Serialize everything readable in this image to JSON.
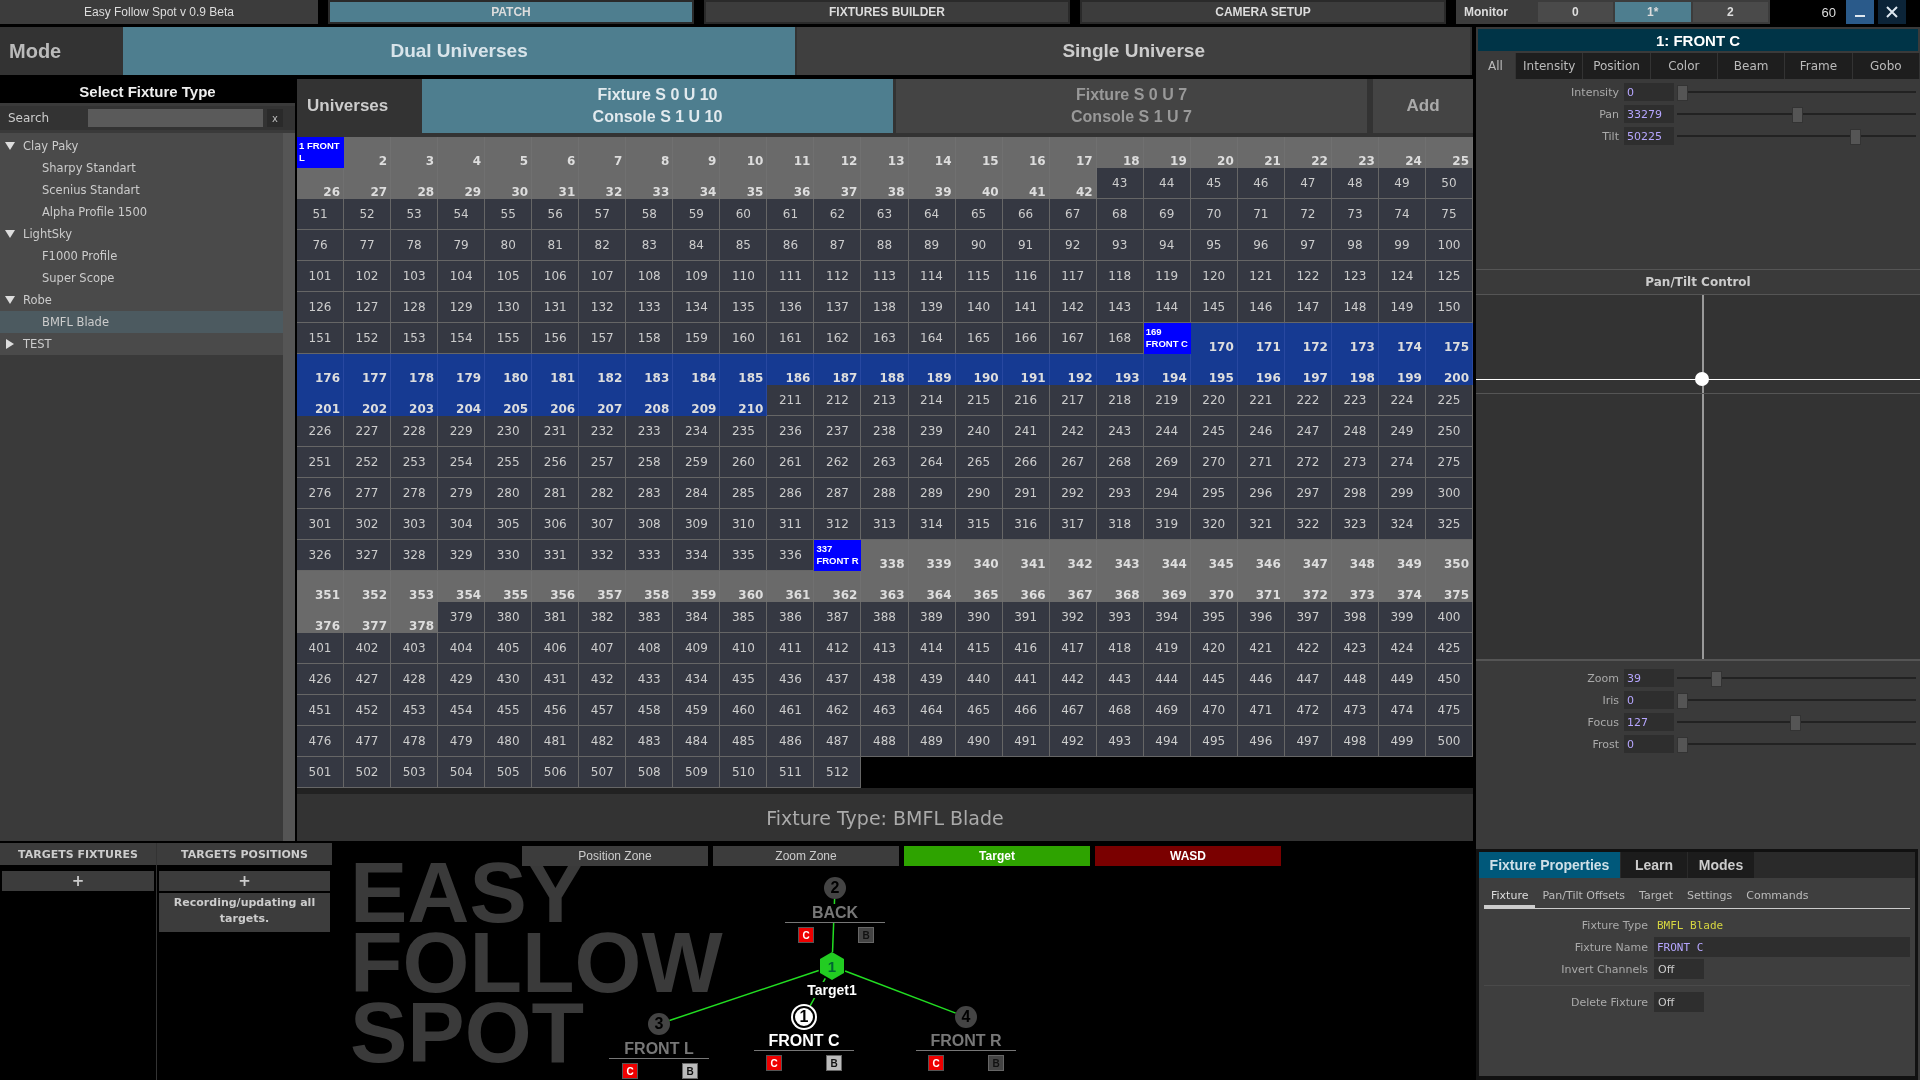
{
  "top_bar": {
    "title": "Easy Follow Spot v 0.9 Beta",
    "tabs": [
      {
        "label": "PATCH",
        "selected": true
      },
      {
        "label": "FIXTURES BUILDER",
        "selected": false
      },
      {
        "label": "CAMERA SETUP",
        "selected": false
      }
    ],
    "monitor": {
      "label": "Monitor",
      "items": [
        {
          "label": "0",
          "selected": false
        },
        {
          "label": "1*",
          "selected": true
        },
        {
          "label": "2",
          "selected": false
        }
      ]
    },
    "fps": "60"
  },
  "mode": {
    "label": "Mode",
    "options": [
      {
        "label": "Dual Universes",
        "selected": true
      },
      {
        "label": "Single Universe",
        "selected": false
      }
    ]
  },
  "fixture_types": {
    "title": "Select Fixture Type",
    "search": {
      "label": "Search",
      "clear": "x"
    },
    "tree": [
      {
        "label": "Clay Paky",
        "expanded": true,
        "selected": false,
        "children": [
          {
            "label": "Sharpy Standart",
            "selected": false
          },
          {
            "label": "Scenius Standart",
            "selected": false
          },
          {
            "label": "Alpha Profile 1500",
            "selected": false
          }
        ]
      },
      {
        "label": "LightSky",
        "expanded": true,
        "selected": false,
        "children": [
          {
            "label": "F1000 Profile",
            "selected": false
          },
          {
            "label": "Super Scope",
            "selected": false
          }
        ]
      },
      {
        "label": "Robe",
        "expanded": true,
        "selected": false,
        "children": [
          {
            "label": "BMFL Blade",
            "selected": true
          }
        ]
      },
      {
        "label": "TEST",
        "expanded": false,
        "selected": false
      }
    ]
  },
  "universes": {
    "label": "Universes",
    "items": [
      {
        "line1": "Fixture S 0 U 10",
        "line2": "Console S 1 U 10",
        "selected": true
      },
      {
        "line1": "Fixture S 0 U 7",
        "line2": "Console S 1 U 7",
        "selected": false
      }
    ],
    "add": "Add"
  },
  "dmx_grid": {
    "segments": [
      {
        "kind": "patched",
        "selected": false,
        "cells": [
          "1 FRONT L",
          "2",
          "3",
          "4",
          "5",
          "6",
          "7",
          "8",
          "9",
          "10",
          "11",
          "12",
          "13",
          "14",
          "15",
          "16",
          "17",
          "18",
          "19",
          "20",
          "21",
          "22",
          "23",
          "24",
          "25",
          "26",
          "27",
          "28",
          "29",
          "30",
          "31",
          "32",
          "33",
          "34",
          "35",
          "36",
          "37",
          "38",
          "39",
          "40",
          "41",
          "42"
        ]
      },
      {
        "kind": "free",
        "cells": [
          "43",
          "44",
          "45",
          "46",
          "47",
          "48",
          "49",
          "50",
          "51",
          "52",
          "53",
          "54",
          "55",
          "56",
          "57",
          "58",
          "59",
          "60",
          "61",
          "62",
          "63",
          "64",
          "65",
          "66",
          "67",
          "68",
          "69",
          "70",
          "71",
          "72",
          "73",
          "74",
          "75",
          "76",
          "77",
          "78",
          "79",
          "80",
          "81",
          "82",
          "83",
          "84",
          "85",
          "86",
          "87",
          "88",
          "89",
          "90",
          "91",
          "92",
          "93",
          "94",
          "95",
          "96",
          "97",
          "98",
          "99",
          "100",
          "101",
          "102",
          "103",
          "104",
          "105",
          "106",
          "107",
          "108",
          "109",
          "110",
          "111",
          "112",
          "113",
          "114",
          "115",
          "116",
          "117",
          "118",
          "119",
          "120",
          "121",
          "122",
          "123",
          "124",
          "125",
          "126",
          "127",
          "128",
          "129",
          "130",
          "131",
          "132",
          "133",
          "134",
          "135",
          "136",
          "137",
          "138",
          "139",
          "140",
          "141",
          "142",
          "143",
          "144",
          "145",
          "146",
          "147",
          "148",
          "149",
          "150",
          "151",
          "152",
          "153",
          "154",
          "155",
          "156",
          "157",
          "158",
          "159",
          "160",
          "161",
          "162",
          "163",
          "164",
          "165",
          "166",
          "167",
          "168"
        ]
      },
      {
        "kind": "patched",
        "selected": true,
        "cells": [
          "169 FRONT C",
          "170",
          "171",
          "172",
          "173",
          "174",
          "175",
          "176",
          "177",
          "178",
          "179",
          "180",
          "181",
          "182",
          "183",
          "184",
          "185",
          "186",
          "187",
          "188",
          "189",
          "190",
          "191",
          "192",
          "193",
          "194",
          "195",
          "196",
          "197",
          "198",
          "199",
          "200",
          "201",
          "202",
          "203",
          "204",
          "205",
          "206",
          "207",
          "208",
          "209",
          "210"
        ]
      },
      {
        "kind": "free",
        "cells": [
          "211",
          "212",
          "213",
          "214",
          "215",
          "216",
          "217",
          "218",
          "219",
          "220",
          "221",
          "222",
          "223",
          "224",
          "225",
          "226",
          "227",
          "228",
          "229",
          "230",
          "231",
          "232",
          "233",
          "234",
          "235",
          "236",
          "237",
          "238",
          "239",
          "240",
          "241",
          "242",
          "243",
          "244",
          "245",
          "246",
          "247",
          "248",
          "249",
          "250",
          "251",
          "252",
          "253",
          "254",
          "255",
          "256",
          "257",
          "258",
          "259",
          "260",
          "261",
          "262",
          "263",
          "264",
          "265",
          "266",
          "267",
          "268",
          "269",
          "270",
          "271",
          "272",
          "273",
          "274",
          "275",
          "276",
          "277",
          "278",
          "279",
          "280",
          "281",
          "282",
          "283",
          "284",
          "285",
          "286",
          "287",
          "288",
          "289",
          "290",
          "291",
          "292",
          "293",
          "294",
          "295",
          "296",
          "297",
          "298",
          "299",
          "300",
          "301",
          "302",
          "303",
          "304",
          "305",
          "306",
          "307",
          "308",
          "309",
          "310",
          "311",
          "312",
          "313",
          "314",
          "315",
          "316",
          "317",
          "318",
          "319",
          "320",
          "321",
          "322",
          "323",
          "324",
          "325",
          "326",
          "327",
          "328",
          "329",
          "330",
          "331",
          "332",
          "333",
          "334",
          "335",
          "336"
        ]
      },
      {
        "kind": "patched",
        "selected": false,
        "cells": [
          "337 FRONT R",
          "338",
          "339",
          "340",
          "341",
          "342",
          "343",
          "344",
          "345",
          "346",
          "347",
          "348",
          "349",
          "350",
          "351",
          "352",
          "353",
          "354",
          "355",
          "356",
          "357",
          "358",
          "359",
          "360",
          "361",
          "362",
          "363",
          "364",
          "365",
          "366",
          "367",
          "368",
          "369",
          "370",
          "371",
          "372",
          "373",
          "374",
          "375",
          "376",
          "377",
          "378"
        ]
      },
      {
        "kind": "free",
        "cells": [
          "379",
          "380",
          "381",
          "382",
          "383",
          "384",
          "385",
          "386",
          "387",
          "388",
          "389",
          "390",
          "391",
          "392",
          "393",
          "394",
          "395",
          "396",
          "397",
          "398",
          "399",
          "400",
          "401",
          "402",
          "403",
          "404",
          "405",
          "406",
          "407",
          "408",
          "409",
          "410",
          "411",
          "412",
          "413",
          "414",
          "415",
          "416",
          "417",
          "418",
          "419",
          "420",
          "421",
          "422",
          "423",
          "424",
          "425",
          "426",
          "427",
          "428",
          "429",
          "430",
          "431",
          "432",
          "433",
          "434",
          "435",
          "436",
          "437",
          "438",
          "439",
          "440",
          "441",
          "442",
          "443",
          "444",
          "445",
          "446",
          "447",
          "448",
          "449",
          "450",
          "451",
          "452",
          "453",
          "454",
          "455",
          "456",
          "457",
          "458",
          "459",
          "460",
          "461",
          "462",
          "463",
          "464",
          "465",
          "466",
          "467",
          "468",
          "469",
          "470",
          "471",
          "472",
          "473",
          "474",
          "475",
          "476",
          "477",
          "478",
          "479",
          "480",
          "481",
          "482",
          "483",
          "484",
          "485",
          "486",
          "487",
          "488",
          "489",
          "490",
          "491",
          "492",
          "493",
          "494",
          "495",
          "496",
          "497",
          "498",
          "499",
          "500",
          "501",
          "502",
          "503",
          "504",
          "505",
          "506",
          "507",
          "508",
          "509",
          "510",
          "511",
          "512"
        ]
      }
    ]
  },
  "fixture_type_caption": "Fixture Type: BMFL Blade",
  "targets": {
    "columns": [
      {
        "title": "TARGETS FIXTURES",
        "add": "+"
      },
      {
        "title": "TARGETS POSITIONS",
        "add": "+",
        "note": "Recording/updating all targets."
      }
    ]
  },
  "canvas": {
    "zones": [
      {
        "label": "Position Zone",
        "kind": "plain"
      },
      {
        "label": "Zoom Zone",
        "kind": "plain"
      },
      {
        "label": "Target",
        "kind": "target"
      },
      {
        "label": "WASD",
        "kind": "wasd"
      }
    ],
    "watermark": [
      "EASY",
      "FOLLOW",
      "SPOT"
    ],
    "target": {
      "number": "1",
      "name": "Target1"
    },
    "nodes": [
      {
        "number": "2",
        "name": "BACK",
        "selected": false,
        "c": "C",
        "b": "B",
        "b_on": false
      },
      {
        "number": "3",
        "name": "FRONT L",
        "selected": false,
        "c": "C",
        "b": "B",
        "b_on": true
      },
      {
        "number": "1",
        "name": "FRONT C",
        "selected": true,
        "c": "C",
        "b": "B",
        "b_on": true
      },
      {
        "number": "4",
        "name": "FRONT R",
        "selected": false,
        "c": "C",
        "b": "B",
        "b_on": false
      }
    ]
  },
  "inspector": {
    "title": "1: FRONT C",
    "tabs": [
      {
        "label": "All",
        "selected": true
      },
      {
        "label": "Intensity",
        "selected": false
      },
      {
        "label": "Position",
        "selected": false
      },
      {
        "label": "Color",
        "selected": false
      },
      {
        "label": "Beam",
        "selected": false
      },
      {
        "label": "Frame",
        "selected": false
      },
      {
        "label": "Gobo",
        "selected": false
      }
    ],
    "channels": [
      {
        "name": "Intensity",
        "value": "0",
        "level": 0
      },
      {
        "name": "Pan",
        "value": "33279",
        "level": 0.51
      },
      {
        "name": "Tilt",
        "value": "50225",
        "level": 0.77
      }
    ],
    "pan_tilt_title": "Pan/Tilt Control",
    "beam_channels": [
      {
        "name": "Zoom",
        "value": "39",
        "level": 0.15
      },
      {
        "name": "Iris",
        "value": "0",
        "level": 0
      },
      {
        "name": "Focus",
        "value": "127",
        "level": 0.5
      },
      {
        "name": "Frost",
        "value": "0",
        "level": 0
      }
    ]
  },
  "properties": {
    "tabs": [
      {
        "label": "Fixture Properties",
        "selected": true
      },
      {
        "label": "Learn",
        "selected": false
      },
      {
        "label": "Modes",
        "selected": false
      }
    ],
    "subtabs": [
      {
        "label": "Fixture",
        "selected": true
      },
      {
        "label": "Pan/Tilt Offsets",
        "selected": false
      },
      {
        "label": "Target",
        "selected": false
      },
      {
        "label": "Settings",
        "selected": false
      },
      {
        "label": "Commands",
        "selected": false
      }
    ],
    "rows": [
      {
        "label": "Fixture Type",
        "value": "BMFL Blade",
        "kind": "text"
      },
      {
        "label": "Fixture Name",
        "value": "FRONT C",
        "kind": "field"
      },
      {
        "label": "Invert Channels",
        "value": "Off",
        "kind": "toggle"
      }
    ],
    "delete": {
      "label": "Delete Fixture",
      "value": "Off"
    }
  }
}
